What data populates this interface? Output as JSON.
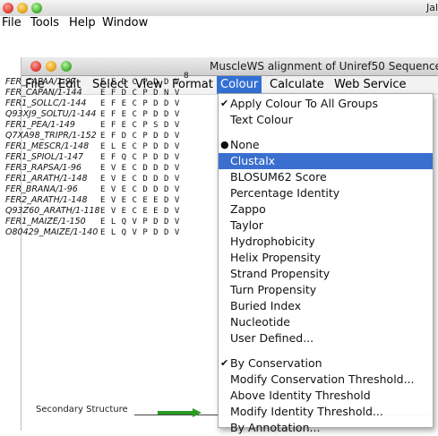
{
  "outer_window": {
    "title": "Jal",
    "menu": [
      "File",
      "Tools",
      "Help",
      "Window"
    ]
  },
  "inner_window": {
    "title": "MuscleWS alignment of Uniref50 Sequences",
    "menu": [
      "File",
      "Edit",
      "Select",
      "View",
      "Format",
      "Colour",
      "Calculate",
      "Web Service"
    ],
    "active_menu": "Colour",
    "ruler_number": "8"
  },
  "sequences": [
    {
      "name": "FER_CAPAA/1-97",
      "residues": "E F D C P D D V"
    },
    {
      "name": "FER_CAPAN/1-144",
      "residues": "E F D C P D N V"
    },
    {
      "name": "FER1_SOLLC/1-144",
      "residues": "E F E C P D D V"
    },
    {
      "name": "Q93XJ9_SOLTU/1-144",
      "residues": "E F E C P D D V"
    },
    {
      "name": "FER1_PEA/1-149",
      "residues": "E F E C P S D V"
    },
    {
      "name": "Q7XA98_TRIPR/1-152",
      "residues": "E F D C P D D V"
    },
    {
      "name": "FER1_MESCR/1-148",
      "residues": "E L E C P D D V"
    },
    {
      "name": "FER1_SPIOL/1-147",
      "residues": "E F Q C P D D V"
    },
    {
      "name": "FER3_RAPSA/1-96",
      "residues": "E V E C D D D V"
    },
    {
      "name": "FER1_ARATH/1-148",
      "residues": "E V E C D D D V"
    },
    {
      "name": "FER_BRANA/1-96",
      "residues": "E V E C D D D V"
    },
    {
      "name": "FER2_ARATH/1-148",
      "residues": "E V E C E E D V"
    },
    {
      "name": "Q93Z60_ARATH/1-118",
      "residues": "E V E C E E D V"
    },
    {
      "name": "FER1_MAIZE/1-150",
      "residues": "E L Q V P D D V"
    },
    {
      "name": "O80429_MAIZE/1-140",
      "residues": "E L Q V P D D V"
    }
  ],
  "annotation": {
    "secondary_structure_label": "Secondary Structure"
  },
  "colour_menu": {
    "items": [
      {
        "label": "Apply Colour To All Groups",
        "checked": true
      },
      {
        "label": "Text Colour",
        "checked": false
      },
      {
        "label": "",
        "separator": true
      },
      {
        "label": "None",
        "radio": true
      },
      {
        "label": "Clustalx",
        "selected": true
      },
      {
        "label": "BLOSUM62 Score"
      },
      {
        "label": "Percentage Identity"
      },
      {
        "label": "Zappo"
      },
      {
        "label": "Taylor"
      },
      {
        "label": "Hydrophobicity"
      },
      {
        "label": "Helix Propensity"
      },
      {
        "label": "Strand Propensity"
      },
      {
        "label": "Turn Propensity"
      },
      {
        "label": "Buried Index"
      },
      {
        "label": "Nucleotide"
      },
      {
        "label": "User Defined..."
      },
      {
        "label": "",
        "separator": true
      },
      {
        "label": "By Conservation",
        "checked": true
      },
      {
        "label": "Modify Conservation Threshold..."
      },
      {
        "label": "Above Identity Threshold"
      },
      {
        "label": "Modify Identity Threshold..."
      },
      {
        "label": "By Annotation..."
      }
    ]
  },
  "colors": {
    "menu_highlight": "#3a6fcf",
    "ss_arrow": "#2a9a22"
  }
}
